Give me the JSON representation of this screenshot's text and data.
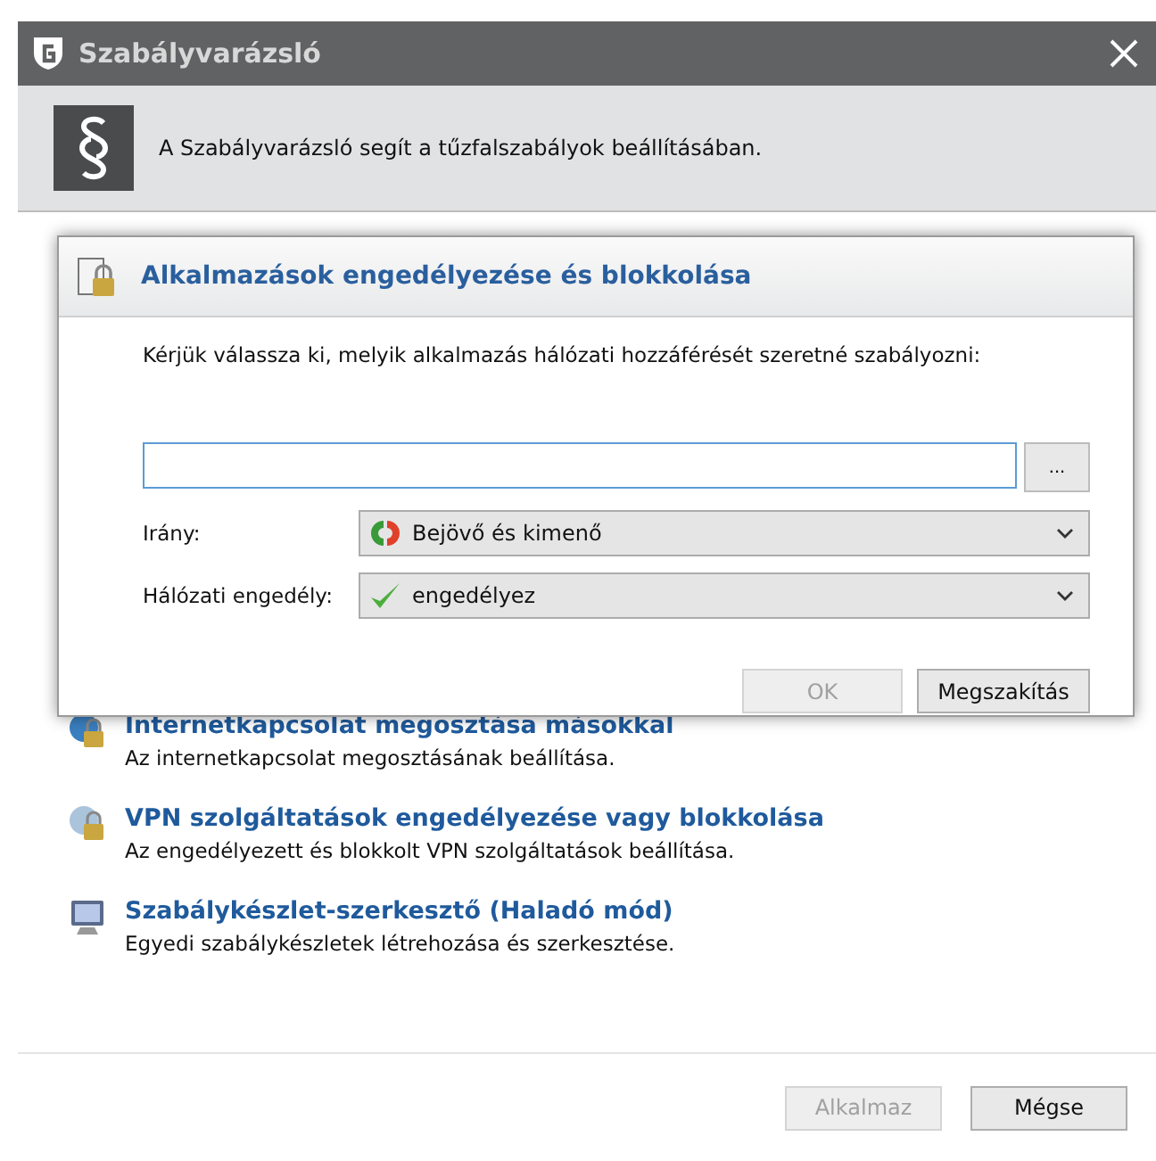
{
  "window": {
    "title": "Szabályvarázsló"
  },
  "header": {
    "text": "A Szabályvarázsló segít a tűzfalszabályok beállításában."
  },
  "tasks": [
    {
      "title": "Internetkapcsolat megosztása másokkal",
      "description": "Az internetkapcsolat megosztásának beállítása."
    },
    {
      "title": "VPN szolgáltatások engedélyezése vagy blokkolása",
      "description": "Az engedélyezett és blokkolt VPN szolgáltatások beállítása."
    },
    {
      "title": "Szabálykészlet-szerkesztő (Haladó mód)",
      "description": "Egyedi szabálykészletek létrehozása és szerkesztése."
    }
  ],
  "buttons": [
    {
      "label": "Alkalmaz",
      "disabled": true
    },
    {
      "label": "Mégse",
      "disabled": false
    }
  ],
  "dialog": {
    "title": "Alkalmazások engedélyezése és blokkolása",
    "instruction": "Kérjük válassza ki, melyik alkalmazás hálózati hozzáférését szeretné szabályozni:",
    "browse": "...",
    "fields": [
      {
        "label": "Irány:",
        "value": "Bejövő és kimenő"
      },
      {
        "label": "Hálózati engedély:",
        "value": "engedélyez"
      }
    ],
    "buttons": [
      {
        "label": "OK",
        "disabled": true
      },
      {
        "label": "Megszakítás",
        "disabled": false
      }
    ]
  }
}
